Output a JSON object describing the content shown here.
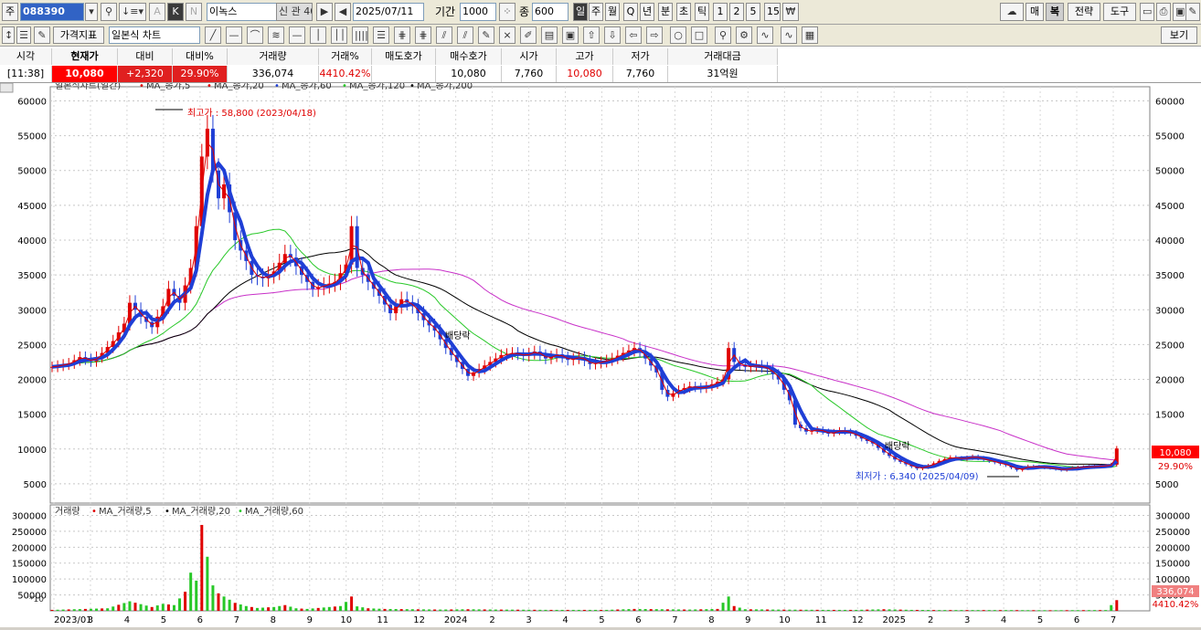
{
  "toolbar": {
    "market_label": "주",
    "code": "088390",
    "name": "이녹스",
    "date": "2025/07/11",
    "period_label": "기간",
    "period_value": "1000",
    "count_label": "종",
    "count_value": "600",
    "period_buttons": [
      "일",
      "주",
      "월",
      "Q",
      "년",
      "분",
      "초",
      "틱",
      "1",
      "2",
      "5",
      "15"
    ],
    "right_buttons": [
      "매",
      "복",
      "전략",
      "도구"
    ],
    "a_label": "A",
    "k_label": "K",
    "n_label": "N"
  },
  "toolbar2": {
    "price_indicator_label": "가격지표",
    "chart_type": "일본식 차트",
    "view_label": "보기"
  },
  "quote": {
    "headers": [
      "시각",
      "현재가",
      "대비",
      "대비%",
      "거래량",
      "거래%",
      "매도호가",
      "매수호가",
      "시가",
      "고가",
      "저가",
      "거래대금"
    ],
    "values": [
      "[11:38]",
      "10,080",
      "+2,320",
      "29.90%",
      "336,074",
      "4410.42%",
      "",
      "10,080",
      "7,760",
      "10,080",
      "7,760",
      "31억원"
    ]
  },
  "chart_data": [
    {
      "type": "candlestick",
      "title": "일본식차트(일간)",
      "legend": [
        "MA_종가,5",
        "MA_종가,20",
        "MA_종가,60",
        "MA_종가,120",
        "MA_종가,200"
      ],
      "legend_colors": [
        "#e00000",
        "#e00000",
        "#1f3fd6",
        "#28c828",
        "#000000",
        "#c830c8"
      ],
      "y_ticks": [
        5000,
        10000,
        15000,
        20000,
        25000,
        30000,
        35000,
        40000,
        45000,
        50000,
        55000,
        60000
      ],
      "ylim": [
        2500,
        61500
      ],
      "x_ticks": [
        "2023/01",
        "3",
        "4",
        "5",
        "6",
        "7",
        "8",
        "9",
        "10",
        "11",
        "12",
        "2024",
        "2",
        "3",
        "4",
        "5",
        "6",
        "7",
        "8",
        "9",
        "10",
        "11",
        "12",
        "2025",
        "2",
        "3",
        "4",
        "5",
        "6",
        "7"
      ],
      "annotations": [
        "최고가 : 58,800 (2023/04/18)",
        "최저가 : 6,340 (2025/04/09)",
        "배당락",
        "배당락"
      ],
      "last_price_label": "10,080",
      "last_change_label": "29.90%",
      "close_series": [
        [
          0,
          21800
        ],
        [
          3,
          22300
        ],
        [
          5,
          23200
        ],
        [
          7,
          22600
        ],
        [
          9,
          23800
        ],
        [
          11,
          25500
        ],
        [
          13,
          28000
        ],
        [
          14,
          31000
        ],
        [
          16,
          29000
        ],
        [
          18,
          27500
        ],
        [
          20,
          30500
        ],
        [
          21,
          33000
        ],
        [
          23,
          31000
        ],
        [
          25,
          36000
        ],
        [
          26,
          42000
        ],
        [
          27,
          52000
        ],
        [
          28,
          56000
        ],
        [
          29,
          50000
        ],
        [
          30,
          46000
        ],
        [
          31,
          48000
        ],
        [
          32,
          44000
        ],
        [
          33,
          40000
        ],
        [
          35,
          37000
        ],
        [
          36,
          35000
        ],
        [
          38,
          34500
        ],
        [
          40,
          35500
        ],
        [
          42,
          38000
        ],
        [
          43,
          37500
        ],
        [
          45,
          35000
        ],
        [
          47,
          33000
        ],
        [
          49,
          33500
        ],
        [
          51,
          34000
        ],
        [
          53,
          36500
        ],
        [
          54,
          42000
        ],
        [
          55,
          36000
        ],
        [
          57,
          34000
        ],
        [
          59,
          32000
        ],
        [
          61,
          29500
        ],
        [
          63,
          31500
        ],
        [
          65,
          30500
        ],
        [
          67,
          28500
        ],
        [
          69,
          27000
        ],
        [
          71,
          24500
        ],
        [
          73,
          22500
        ],
        [
          75,
          20500
        ],
        [
          77,
          21500
        ],
        [
          79,
          22500
        ],
        [
          81,
          23500
        ],
        [
          83,
          23800
        ],
        [
          85,
          23400
        ],
        [
          87,
          24000
        ],
        [
          89,
          23000
        ],
        [
          91,
          23600
        ],
        [
          93,
          22800
        ],
        [
          95,
          23200
        ],
        [
          97,
          22200
        ],
        [
          99,
          22500
        ],
        [
          101,
          23000
        ],
        [
          103,
          23800
        ],
        [
          105,
          24500
        ],
        [
          106,
          24000
        ],
        [
          107,
          23000
        ],
        [
          109,
          21000
        ],
        [
          110,
          18500
        ],
        [
          111,
          17500
        ],
        [
          113,
          18500
        ],
        [
          115,
          19000
        ],
        [
          117,
          18700
        ],
        [
          119,
          19300
        ],
        [
          121,
          20000
        ],
        [
          122,
          24500
        ],
        [
          123,
          22500
        ],
        [
          125,
          21800
        ],
        [
          127,
          22000
        ],
        [
          129,
          21500
        ],
        [
          131,
          20000
        ],
        [
          133,
          17000
        ],
        [
          134,
          13500
        ],
        [
          136,
          12500
        ],
        [
          138,
          12800
        ],
        [
          140,
          12200
        ],
        [
          142,
          12700
        ],
        [
          144,
          12300
        ],
        [
          146,
          11500
        ],
        [
          148,
          10800
        ],
        [
          150,
          9500
        ],
        [
          152,
          8500
        ],
        [
          154,
          7800
        ],
        [
          156,
          7200
        ],
        [
          158,
          7600
        ],
        [
          160,
          8300
        ],
        [
          162,
          8800
        ],
        [
          164,
          8600
        ],
        [
          166,
          8900
        ],
        [
          168,
          8500
        ],
        [
          170,
          8100
        ],
        [
          172,
          7700
        ],
        [
          174,
          7000
        ],
        [
          176,
          7500
        ],
        [
          178,
          7400
        ],
        [
          180,
          7300
        ],
        [
          182,
          7000
        ],
        [
          184,
          7300
        ],
        [
          186,
          7400
        ],
        [
          188,
          7500
        ],
        [
          190,
          7600
        ],
        [
          191,
          7760
        ],
        [
          192,
          10080
        ]
      ]
    },
    {
      "type": "bar",
      "title": "거래량",
      "legend": [
        "MA_거래량,5",
        "MA_거래량,20",
        "MA_거래량,60"
      ],
      "legend_colors": [
        "#e00000",
        "#000000",
        "#28c828"
      ],
      "y_ticks": [
        50000,
        100000,
        150000,
        200000,
        250000,
        300000
      ],
      "ylim": [
        0,
        310000
      ],
      "unit_label": "*10",
      "last_volume_label": "336,074",
      "last_volume_pct_label": "4410.42%",
      "volume_series": [
        [
          0,
          3000
        ],
        [
          10,
          8000
        ],
        [
          14,
          30000
        ],
        [
          18,
          12000
        ],
        [
          20,
          22000
        ],
        [
          22,
          18000
        ],
        [
          24,
          60000
        ],
        [
          25,
          120000
        ],
        [
          26,
          95000
        ],
        [
          27,
          270000
        ],
        [
          28,
          170000
        ],
        [
          29,
          80000
        ],
        [
          30,
          55000
        ],
        [
          31,
          45000
        ],
        [
          33,
          25000
        ],
        [
          35,
          15000
        ],
        [
          37,
          9000
        ],
        [
          40,
          12000
        ],
        [
          42,
          18000
        ],
        [
          44,
          8000
        ],
        [
          46,
          6000
        ],
        [
          48,
          9000
        ],
        [
          52,
          15000
        ],
        [
          53,
          28000
        ],
        [
          54,
          45000
        ],
        [
          55,
          14000
        ],
        [
          57,
          8000
        ],
        [
          60,
          6000
        ],
        [
          65,
          5000
        ],
        [
          70,
          4000
        ],
        [
          75,
          5000
        ],
        [
          80,
          4000
        ],
        [
          90,
          3000
        ],
        [
          100,
          3000
        ],
        [
          105,
          6000
        ],
        [
          110,
          5000
        ],
        [
          115,
          4000
        ],
        [
          120,
          6000
        ],
        [
          122,
          45000
        ],
        [
          123,
          15000
        ],
        [
          125,
          5000
        ],
        [
          130,
          4000
        ],
        [
          135,
          3500
        ],
        [
          140,
          3000
        ],
        [
          145,
          3000
        ],
        [
          150,
          5000
        ],
        [
          155,
          3000
        ],
        [
          160,
          2500
        ],
        [
          170,
          2500
        ],
        [
          180,
          2000
        ],
        [
          190,
          2500
        ],
        [
          192,
          33600
        ]
      ]
    }
  ]
}
